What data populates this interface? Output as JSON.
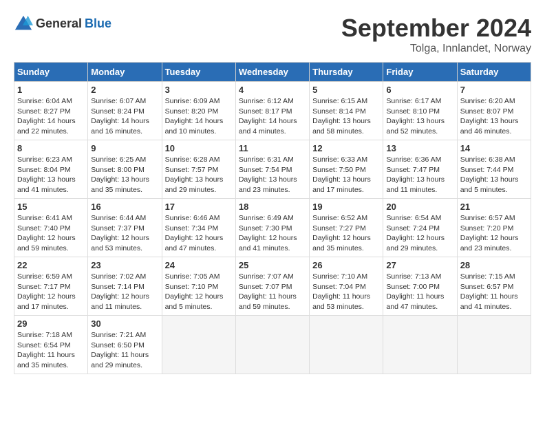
{
  "header": {
    "logo_general": "General",
    "logo_blue": "Blue",
    "title": "September 2024",
    "location": "Tolga, Innlandet, Norway"
  },
  "calendar": {
    "days_of_week": [
      "Sunday",
      "Monday",
      "Tuesday",
      "Wednesday",
      "Thursday",
      "Friday",
      "Saturday"
    ],
    "weeks": [
      [
        {
          "day": "1",
          "sunrise": "6:04 AM",
          "sunset": "8:27 PM",
          "daylight": "14 hours and 22 minutes."
        },
        {
          "day": "2",
          "sunrise": "6:07 AM",
          "sunset": "8:24 PM",
          "daylight": "14 hours and 16 minutes."
        },
        {
          "day": "3",
          "sunrise": "6:09 AM",
          "sunset": "8:20 PM",
          "daylight": "14 hours and 10 minutes."
        },
        {
          "day": "4",
          "sunrise": "6:12 AM",
          "sunset": "8:17 PM",
          "daylight": "14 hours and 4 minutes."
        },
        {
          "day": "5",
          "sunrise": "6:15 AM",
          "sunset": "8:14 PM",
          "daylight": "13 hours and 58 minutes."
        },
        {
          "day": "6",
          "sunrise": "6:17 AM",
          "sunset": "8:10 PM",
          "daylight": "13 hours and 52 minutes."
        },
        {
          "day": "7",
          "sunrise": "6:20 AM",
          "sunset": "8:07 PM",
          "daylight": "13 hours and 46 minutes."
        }
      ],
      [
        {
          "day": "8",
          "sunrise": "6:23 AM",
          "sunset": "8:04 PM",
          "daylight": "13 hours and 41 minutes."
        },
        {
          "day": "9",
          "sunrise": "6:25 AM",
          "sunset": "8:00 PM",
          "daylight": "13 hours and 35 minutes."
        },
        {
          "day": "10",
          "sunrise": "6:28 AM",
          "sunset": "7:57 PM",
          "daylight": "13 hours and 29 minutes."
        },
        {
          "day": "11",
          "sunrise": "6:31 AM",
          "sunset": "7:54 PM",
          "daylight": "13 hours and 23 minutes."
        },
        {
          "day": "12",
          "sunrise": "6:33 AM",
          "sunset": "7:50 PM",
          "daylight": "13 hours and 17 minutes."
        },
        {
          "day": "13",
          "sunrise": "6:36 AM",
          "sunset": "7:47 PM",
          "daylight": "13 hours and 11 minutes."
        },
        {
          "day": "14",
          "sunrise": "6:38 AM",
          "sunset": "7:44 PM",
          "daylight": "13 hours and 5 minutes."
        }
      ],
      [
        {
          "day": "15",
          "sunrise": "6:41 AM",
          "sunset": "7:40 PM",
          "daylight": "12 hours and 59 minutes."
        },
        {
          "day": "16",
          "sunrise": "6:44 AM",
          "sunset": "7:37 PM",
          "daylight": "12 hours and 53 minutes."
        },
        {
          "day": "17",
          "sunrise": "6:46 AM",
          "sunset": "7:34 PM",
          "daylight": "12 hours and 47 minutes."
        },
        {
          "day": "18",
          "sunrise": "6:49 AM",
          "sunset": "7:30 PM",
          "daylight": "12 hours and 41 minutes."
        },
        {
          "day": "19",
          "sunrise": "6:52 AM",
          "sunset": "7:27 PM",
          "daylight": "12 hours and 35 minutes."
        },
        {
          "day": "20",
          "sunrise": "6:54 AM",
          "sunset": "7:24 PM",
          "daylight": "12 hours and 29 minutes."
        },
        {
          "day": "21",
          "sunrise": "6:57 AM",
          "sunset": "7:20 PM",
          "daylight": "12 hours and 23 minutes."
        }
      ],
      [
        {
          "day": "22",
          "sunrise": "6:59 AM",
          "sunset": "7:17 PM",
          "daylight": "12 hours and 17 minutes."
        },
        {
          "day": "23",
          "sunrise": "7:02 AM",
          "sunset": "7:14 PM",
          "daylight": "12 hours and 11 minutes."
        },
        {
          "day": "24",
          "sunrise": "7:05 AM",
          "sunset": "7:10 PM",
          "daylight": "12 hours and 5 minutes."
        },
        {
          "day": "25",
          "sunrise": "7:07 AM",
          "sunset": "7:07 PM",
          "daylight": "11 hours and 59 minutes."
        },
        {
          "day": "26",
          "sunrise": "7:10 AM",
          "sunset": "7:04 PM",
          "daylight": "11 hours and 53 minutes."
        },
        {
          "day": "27",
          "sunrise": "7:13 AM",
          "sunset": "7:00 PM",
          "daylight": "11 hours and 47 minutes."
        },
        {
          "day": "28",
          "sunrise": "7:15 AM",
          "sunset": "6:57 PM",
          "daylight": "11 hours and 41 minutes."
        }
      ],
      [
        {
          "day": "29",
          "sunrise": "7:18 AM",
          "sunset": "6:54 PM",
          "daylight": "11 hours and 35 minutes."
        },
        {
          "day": "30",
          "sunrise": "7:21 AM",
          "sunset": "6:50 PM",
          "daylight": "11 hours and 29 minutes."
        },
        null,
        null,
        null,
        null,
        null
      ]
    ]
  }
}
